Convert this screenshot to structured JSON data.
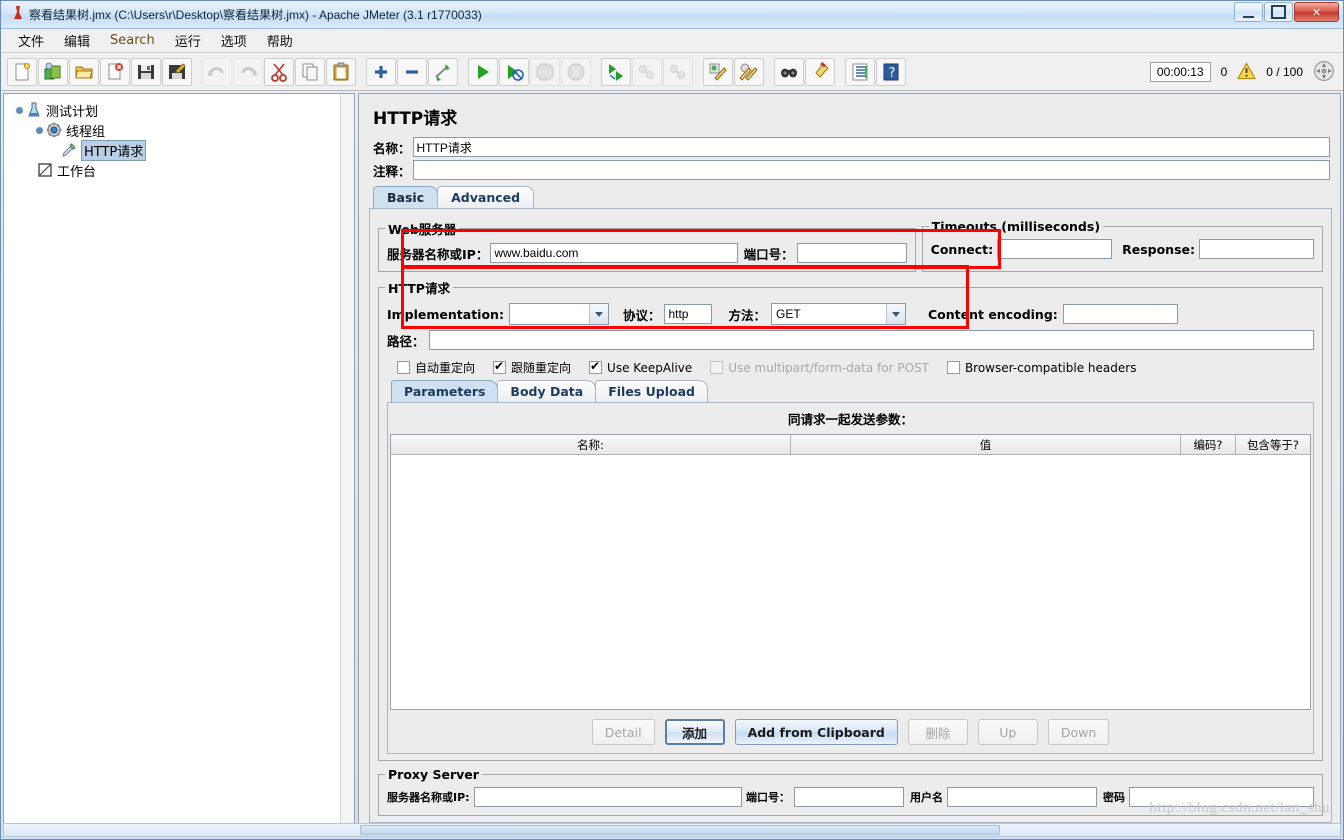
{
  "window": {
    "title": "察看结果树.jmx (C:\\Users\\r\\Desktop\\察看结果树.jmx) - Apache JMeter (3.1 r1770033)",
    "app_icon": "jmeter-flask-icon",
    "minimize_label": "",
    "maximize_label": "",
    "close_label": "✕"
  },
  "menubar": {
    "items": [
      {
        "label": "文件",
        "name": "menu-file"
      },
      {
        "label": "编辑",
        "name": "menu-edit"
      },
      {
        "label": "Search",
        "name": "menu-search"
      },
      {
        "label": "运行",
        "name": "menu-run"
      },
      {
        "label": "选项",
        "name": "menu-options"
      },
      {
        "label": "帮助",
        "name": "menu-help"
      }
    ]
  },
  "toolbar": {
    "buttons": [
      {
        "name": "new-icon",
        "title": "New"
      },
      {
        "name": "templates-icon",
        "title": "Templates"
      },
      {
        "name": "open-icon",
        "title": "Open"
      },
      {
        "name": "close-icon",
        "title": "Close"
      },
      {
        "name": "save-icon",
        "title": "Save"
      },
      {
        "name": "save-as-icon",
        "title": "Save as"
      },
      {
        "name": "undo-icon",
        "title": "Undo",
        "disabled": true
      },
      {
        "name": "redo-icon",
        "title": "Redo",
        "disabled": true
      },
      {
        "name": "cut-icon",
        "title": "Cut"
      },
      {
        "name": "copy-icon",
        "title": "Copy"
      },
      {
        "name": "paste-icon",
        "title": "Paste"
      },
      {
        "name": "expand-all-icon",
        "title": "Expand all"
      },
      {
        "name": "collapse-all-icon",
        "title": "Collapse all"
      },
      {
        "name": "toggle-icon",
        "title": "Toggle"
      },
      {
        "name": "start-icon",
        "title": "Start"
      },
      {
        "name": "start-no-pause-icon",
        "title": "Start no timers"
      },
      {
        "name": "stop-icon",
        "title": "Stop",
        "disabled": true
      },
      {
        "name": "shutdown-icon",
        "title": "Shutdown",
        "disabled": true
      },
      {
        "name": "start-remote-icon",
        "title": "Remote start all"
      },
      {
        "name": "stop-remote-icon",
        "title": "Remote stop all",
        "disabled": true
      },
      {
        "name": "shutdown-remote-icon",
        "title": "Remote shutdown all",
        "disabled": true
      },
      {
        "name": "clear-icon",
        "title": "Clear"
      },
      {
        "name": "clear-all-icon",
        "title": "Clear all"
      },
      {
        "name": "search-icon",
        "title": "Search"
      },
      {
        "name": "search-reset-icon",
        "title": "Reset search"
      },
      {
        "name": "function-helper-icon",
        "title": "Function helper dialog"
      },
      {
        "name": "help-icon",
        "title": "Help"
      }
    ],
    "status": {
      "timer": "00:00:13",
      "error_count": "0",
      "warning_icon": "warning-triangle-icon",
      "threads": "0 / 100",
      "thread-state-icon": "thread-state-icon"
    }
  },
  "tree": {
    "nodes": [
      {
        "label": "测试计划",
        "icon": "test-plan-icon",
        "level": 0,
        "selected": false
      },
      {
        "label": "线程组",
        "icon": "thread-group-icon",
        "level": 1,
        "selected": false
      },
      {
        "label": "HTTP请求",
        "icon": "http-request-icon",
        "level": 2,
        "selected": true
      },
      {
        "label": "工作台",
        "icon": "workbench-icon",
        "level": 0,
        "selected": false
      }
    ]
  },
  "panel": {
    "title": "HTTP请求",
    "name_label": "名称：",
    "name_value": "HTTP请求",
    "comment_label": "注释：",
    "comment_value": "",
    "tabs": [
      {
        "label": "Basic",
        "active": true
      },
      {
        "label": "Advanced",
        "active": false
      }
    ],
    "web_server": {
      "legend": "Web服务器",
      "server_label": "服务器名称或IP：",
      "server_value": "www.baidu.com",
      "port_label": "端口号：",
      "port_value": ""
    },
    "timeouts": {
      "legend": "Timeouts (milliseconds)",
      "connect_label": "Connect:",
      "connect_value": "",
      "response_label": "Response:",
      "response_value": ""
    },
    "http_request": {
      "legend": "HTTP请求",
      "implementation_label": "Implementation:",
      "implementation_value": "",
      "protocol_label": "协议：",
      "protocol_value": "http",
      "method_label": "方法：",
      "method_value": "GET",
      "content_encoding_label": "Content encoding:",
      "content_encoding_value": ""
    },
    "path_label": "路径：",
    "path_value": "",
    "checkboxes": [
      {
        "label": "自动重定向",
        "checked": false,
        "disabled": false,
        "name": "checkbox-auto-redirect"
      },
      {
        "label": "跟随重定向",
        "checked": true,
        "disabled": false,
        "name": "checkbox-follow-redirects"
      },
      {
        "label": "Use KeepAlive",
        "checked": true,
        "disabled": false,
        "name": "checkbox-use-keepalive"
      },
      {
        "label": "Use multipart/form-data for POST",
        "checked": false,
        "disabled": true,
        "name": "checkbox-use-multipart"
      },
      {
        "label": "Browser-compatible headers",
        "checked": false,
        "disabled": false,
        "name": "checkbox-browser-compatible-headers"
      }
    ],
    "param_tabs": [
      {
        "label": "Parameters",
        "active": true
      },
      {
        "label": "Body Data",
        "active": false
      },
      {
        "label": "Files Upload",
        "active": false
      }
    ],
    "params_table": {
      "caption": "同请求一起发送参数：",
      "columns": [
        "名称:",
        "值",
        "编码?",
        "包含等于?"
      ],
      "rows": []
    },
    "action_buttons": [
      {
        "label": "Detail",
        "disabled": true,
        "name": "detail-button"
      },
      {
        "label": "添加",
        "disabled": false,
        "focused": true,
        "name": "add-button"
      },
      {
        "label": "Add from Clipboard",
        "disabled": false,
        "primary": true,
        "name": "add-from-clipboard-button"
      },
      {
        "label": "删除",
        "disabled": true,
        "name": "delete-button"
      },
      {
        "label": "Up",
        "disabled": true,
        "name": "up-button"
      },
      {
        "label": "Down",
        "disabled": true,
        "name": "down-button"
      }
    ],
    "proxy_server": {
      "legend": "Proxy Server",
      "server_label": "服务器名称或IP:",
      "server_value": "",
      "port_label": "端口号：",
      "port_value": "",
      "username_label": "用户名",
      "username_value": "",
      "password_label": "密码",
      "password_value": ""
    }
  },
  "watermark": "http://blog.csdn.net/lan_shu",
  "colors": {
    "annotation": "#ff0000",
    "selection": "#b8cfe5",
    "tab_active": "#cfe0f0"
  }
}
